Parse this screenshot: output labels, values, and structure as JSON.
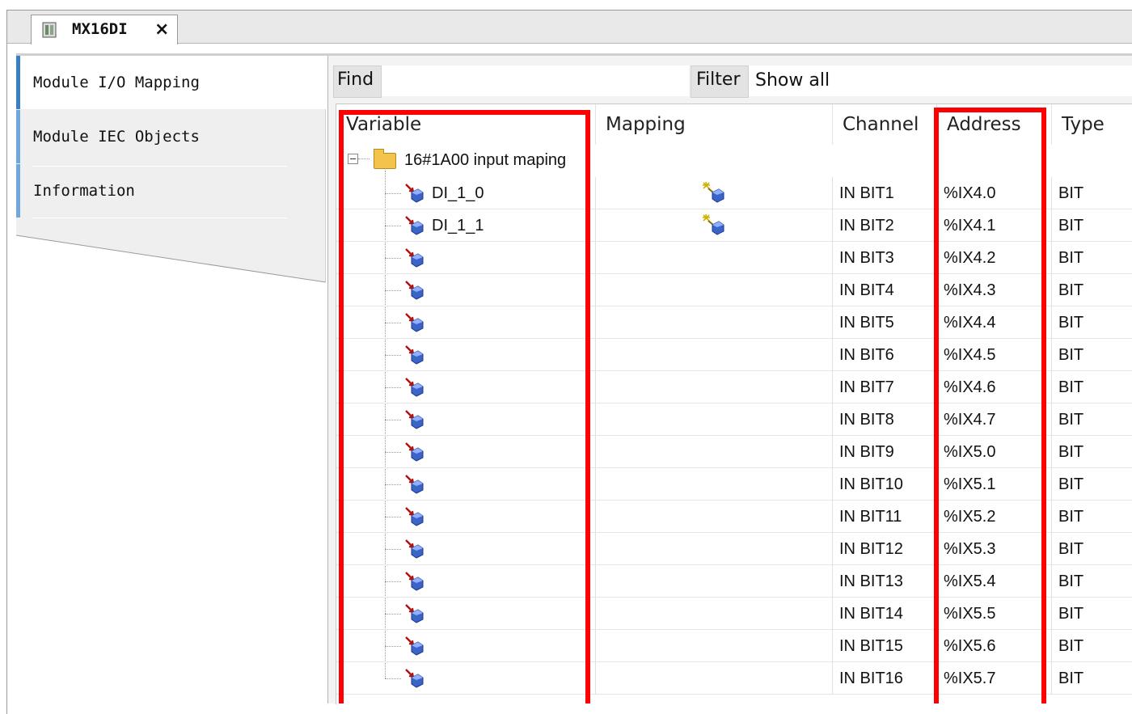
{
  "editor": {
    "tab_title": "MX16DI",
    "tab_close": "×",
    "tab_icon": "device-module-icon"
  },
  "sidebar": {
    "items": [
      {
        "label": "Module I/O Mapping",
        "active": true
      },
      {
        "label": "Module IEC Objects",
        "active": false
      },
      {
        "label": "Information",
        "active": false
      }
    ]
  },
  "toolbar": {
    "find_label": "Find",
    "find_value": "",
    "filter_label": "Filter",
    "filter_value": "Show all"
  },
  "grid": {
    "columns": [
      "Variable",
      "Mapping",
      "Channel",
      "Address",
      "Type"
    ],
    "group": {
      "label": "16#1A00 input maping",
      "expanded": true
    },
    "rows": [
      {
        "variable": "DI_1_0",
        "mapped": true,
        "channel": "IN BIT1",
        "address": "%IX4.0",
        "type": "BIT"
      },
      {
        "variable": "DI_1_1",
        "mapped": true,
        "channel": "IN BIT2",
        "address": "%IX4.1",
        "type": "BIT"
      },
      {
        "variable": "",
        "mapped": false,
        "channel": "IN BIT3",
        "address": "%IX4.2",
        "type": "BIT"
      },
      {
        "variable": "",
        "mapped": false,
        "channel": "IN BIT4",
        "address": "%IX4.3",
        "type": "BIT"
      },
      {
        "variable": "",
        "mapped": false,
        "channel": "IN BIT5",
        "address": "%IX4.4",
        "type": "BIT"
      },
      {
        "variable": "",
        "mapped": false,
        "channel": "IN BIT6",
        "address": "%IX4.5",
        "type": "BIT"
      },
      {
        "variable": "",
        "mapped": false,
        "channel": "IN BIT7",
        "address": "%IX4.6",
        "type": "BIT"
      },
      {
        "variable": "",
        "mapped": false,
        "channel": "IN BIT8",
        "address": "%IX4.7",
        "type": "BIT"
      },
      {
        "variable": "",
        "mapped": false,
        "channel": "IN BIT9",
        "address": "%IX5.0",
        "type": "BIT"
      },
      {
        "variable": "",
        "mapped": false,
        "channel": "IN BIT10",
        "address": "%IX5.1",
        "type": "BIT"
      },
      {
        "variable": "",
        "mapped": false,
        "channel": "IN BIT11",
        "address": "%IX5.2",
        "type": "BIT"
      },
      {
        "variable": "",
        "mapped": false,
        "channel": "IN BIT12",
        "address": "%IX5.3",
        "type": "BIT"
      },
      {
        "variable": "",
        "mapped": false,
        "channel": "IN BIT13",
        "address": "%IX5.4",
        "type": "BIT"
      },
      {
        "variable": "",
        "mapped": false,
        "channel": "IN BIT14",
        "address": "%IX5.5",
        "type": "BIT"
      },
      {
        "variable": "",
        "mapped": false,
        "channel": "IN BIT15",
        "address": "%IX5.6",
        "type": "BIT"
      },
      {
        "variable": "",
        "mapped": false,
        "channel": "IN BIT16",
        "address": "%IX5.7",
        "type": "BIT"
      }
    ]
  },
  "colors": {
    "highlight": "#ff0000",
    "active_tab_bar": "#3a7fc4",
    "tab_bar": "#6fa8dc"
  },
  "icons": {
    "row_icon": "input-channel-icon",
    "mapping_icon": "mapped-variable-icon",
    "group_icon": "folder-icon",
    "expander": "collapse-minus-icon"
  }
}
